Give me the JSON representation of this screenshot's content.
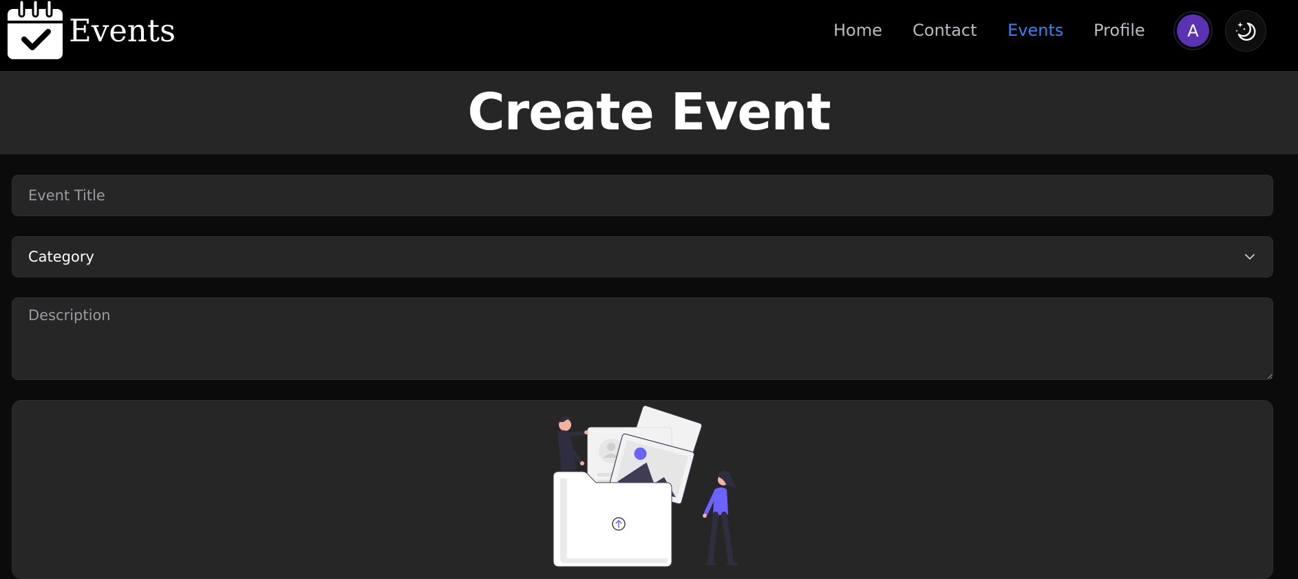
{
  "brand": {
    "name": "Events",
    "icon": "calendar-check-icon"
  },
  "nav": {
    "links": [
      {
        "label": "Home",
        "active": false
      },
      {
        "label": "Contact",
        "active": false
      },
      {
        "label": "Events",
        "active": true
      },
      {
        "label": "Profile",
        "active": false
      }
    ],
    "avatar_initial": "A",
    "theme_toggle_icon": "moon-stars-icon"
  },
  "page": {
    "title": "Create Event"
  },
  "form": {
    "title": {
      "placeholder": "Event Title",
      "value": ""
    },
    "category": {
      "selected": "Category",
      "icon": "chevron-down-icon"
    },
    "description": {
      "placeholder": "Description",
      "value": ""
    },
    "upload": {
      "icon": "upload-arrow-icon"
    }
  },
  "colors": {
    "accent": "#3b82f6",
    "avatar_bg": "#5b32b4",
    "illustration_accent": "#6c63ff"
  }
}
